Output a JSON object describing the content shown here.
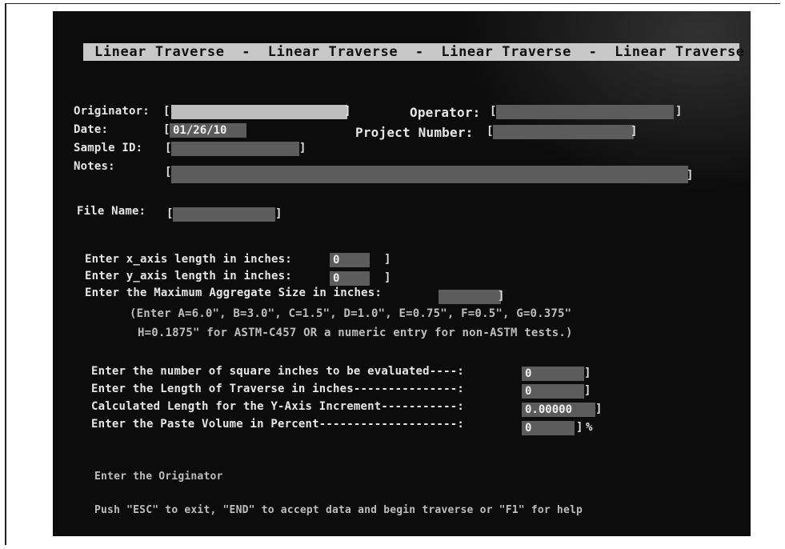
{
  "title": "Linear Traverse  -  Linear Traverse  -  Linear Traverse  -  Linear Traverse",
  "header": {
    "originator_label": "Originator:",
    "originator_value": "",
    "operator_label": "Operator:",
    "operator_value": "",
    "date_label": "Date:",
    "date_value": "01/26/10",
    "project_label": "Project Number:",
    "project_value": "",
    "sample_label": "Sample ID:",
    "sample_value": "",
    "notes_label": "Notes:",
    "notes_value": "",
    "file_label": "File Name:",
    "file_value": ""
  },
  "axes": {
    "x_label": "Enter x_axis length in inches:",
    "x_value": "0",
    "y_label": "Enter y_axis length in inches:",
    "y_value": "0",
    "max_agg_label": "Enter the Maximum Aggregate Size in inches:",
    "max_agg_value": "",
    "hint_line1": "(Enter A=6.0\", B=3.0\", C=1.5\", D=1.0\", E=0.75\", F=0.5\", G=0.375\"",
    "hint_line2": "H=0.1875\" for ASTM-C457 OR a numeric entry for non-ASTM tests.)"
  },
  "calc": {
    "sq_label": "Enter the number of square inches to be evaluated----:",
    "sq_value": "0",
    "traverse_label": "Enter the Length of Traverse in inches---------------:",
    "traverse_value": "0",
    "yinc_label": "Calculated Length for the Y-Axis Increment-----------:",
    "yinc_value": "0.00000",
    "paste_label": "Enter the Paste Volume in Percent--------------------:",
    "paste_value": "0",
    "paste_unit": "%"
  },
  "status": {
    "prompt": "Enter the Originator",
    "help": "Push \"ESC\" to exit, \"END\" to accept data and begin traverse or \"F1\" for help"
  }
}
